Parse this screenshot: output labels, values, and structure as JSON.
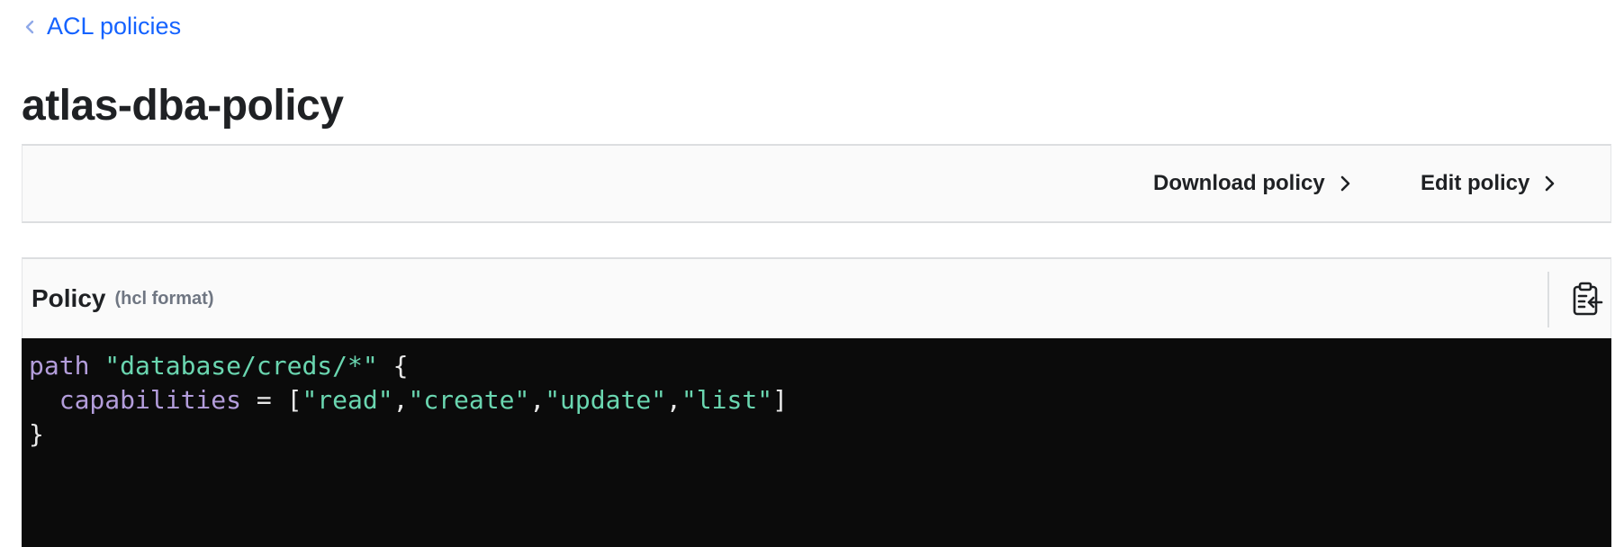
{
  "breadcrumb": {
    "label": "ACL policies"
  },
  "page": {
    "title": "atlas-dba-policy"
  },
  "toolbar": {
    "download_label": "Download policy",
    "edit_label": "Edit policy"
  },
  "policy": {
    "label": "Policy",
    "format_label": "(hcl format)",
    "copy_icon": "clipboard-copy-icon",
    "code": {
      "line1": {
        "keyword": "path",
        "space": " ",
        "string": "\"database/creds/*\"",
        "tail": " {"
      },
      "line2": {
        "indent": "  ",
        "keyword": "capabilities",
        "op": " = [",
        "s1": "\"read\"",
        "c1": ",",
        "s2": "\"create\"",
        "c2": ",",
        "s3": "\"update\"",
        "c3": ",",
        "s4": "\"list\"",
        "close": "]"
      },
      "line3": {
        "text": "}"
      }
    }
  },
  "colors": {
    "link": "#1563ff",
    "code_background": "#0b0b0b",
    "code_keyword": "#b39ddb",
    "code_string": "#6ad6b0",
    "panel_background": "#fafafa"
  }
}
